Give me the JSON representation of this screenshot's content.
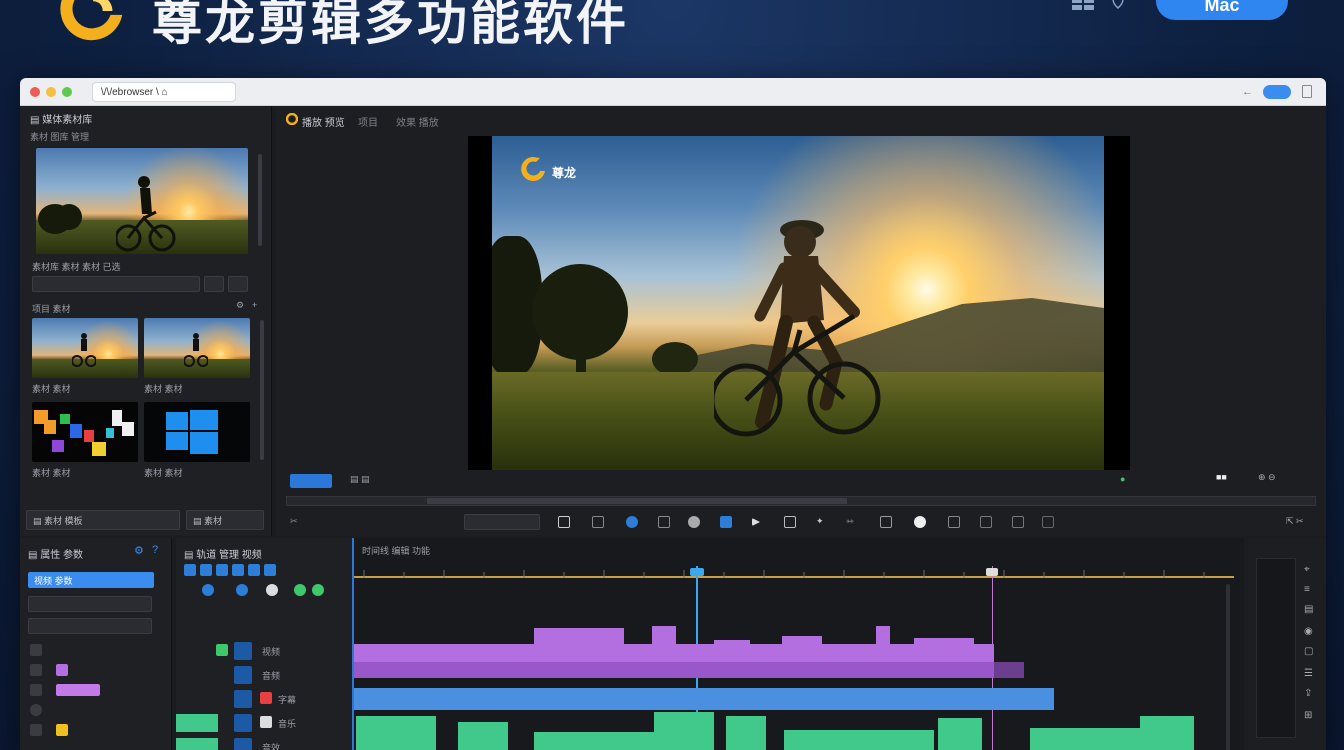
{
  "banner": {
    "title": "尊龙剪辑多功能软件",
    "windows_icon": "windows-icon",
    "apple_icon": "apple-icon",
    "mac_button": "Mac"
  },
  "window": {
    "address": "\\/\\/ebrowser \\ ⌂",
    "back_icon": "←"
  },
  "media": {
    "header": "▤ 媒体素材库",
    "subheader": "素材 图库 管理",
    "clip_info": "素材库 素材 素材 已选",
    "section_label": "项目 素材",
    "thumb1_label": "素材 素材",
    "thumb2_label": "素材 素材",
    "thumb3_label": "素材 素材",
    "thumb4_label": "素材 素材",
    "footer_label": "▤ 素材 模板",
    "footer_right": "▤ 素材"
  },
  "preview": {
    "header_title": "播放 预览",
    "header_tab2": "项目",
    "header_tab3": "效果 播放",
    "watermark": "尊龙"
  },
  "props": {
    "header": "▤ 属性 参数",
    "blue_field": "视频 参数"
  },
  "tracks": {
    "header": "▤ 轨道 管理 视频",
    "rows": [
      "视频",
      "音频",
      "字幕",
      "音乐",
      "音效"
    ]
  },
  "timeline": {
    "header": "时间线 编辑 功能",
    "colors": {
      "purple": "#b36fe0",
      "blue": "#4a8fe0",
      "green": "#41c98c",
      "playhead": "#3aa8f0",
      "ruler": "#c8a040"
    }
  },
  "icons": [
    "app-logo-icon",
    "play-icon",
    "scissors-icon",
    "crop-icon",
    "record-icon",
    "folder-icon",
    "settings-icon",
    "trash-icon",
    "zoom-icon",
    "volume-icon"
  ]
}
